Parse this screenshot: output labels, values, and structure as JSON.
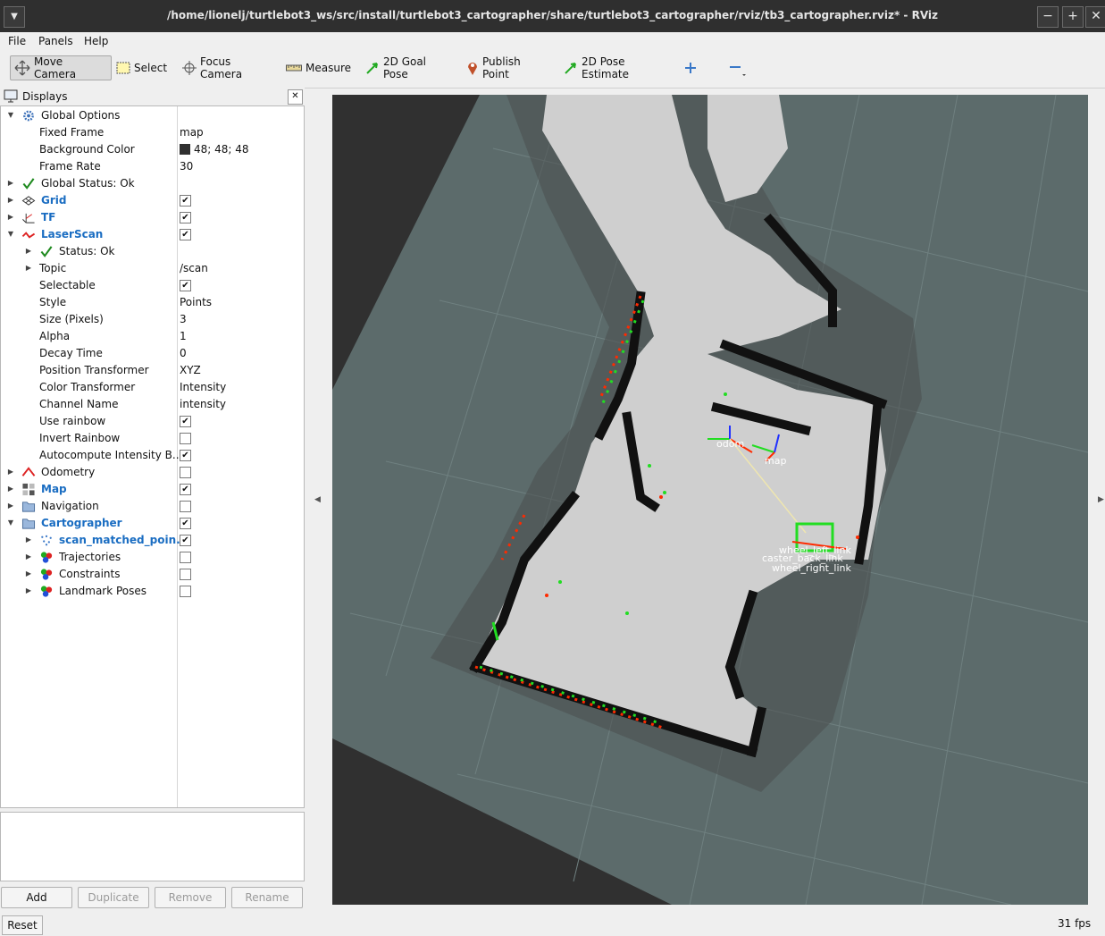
{
  "window": {
    "title": "/home/lionelj/turtlebot3_ws/src/install/turtlebot3_cartographer/share/turtlebot3_cartographer/rviz/tb3_cartographer.rviz* - RViz",
    "menu_icon": "chevron-down-icon",
    "minimize": "−",
    "maximize": "+",
    "close": "✕"
  },
  "menu": {
    "file": "File",
    "panels": "Panels",
    "help": "Help"
  },
  "toolbar": {
    "move_camera": "Move Camera",
    "select": "Select",
    "focus_camera": "Focus Camera",
    "measure": "Measure",
    "goal_pose": "2D Goal Pose",
    "publish_point": "Publish Point",
    "pose_estimate": "2D Pose Estimate"
  },
  "displays": {
    "title": "Displays",
    "close": "✕",
    "rows": [
      {
        "label": "Global Options",
        "expanded": true,
        "icon": "gear-icon"
      },
      {
        "label": "Fixed Frame",
        "value": "map"
      },
      {
        "label": "Background Color",
        "value": "48; 48; 48",
        "color": "#303030"
      },
      {
        "label": "Frame Rate",
        "value": "30"
      },
      {
        "label": "Global Status: Ok",
        "icon": "check-icon"
      },
      {
        "label": "Grid",
        "checked": true,
        "icon": "grid-icon"
      },
      {
        "label": "TF",
        "checked": true,
        "icon": "tf-icon"
      },
      {
        "label": "LaserScan",
        "checked": true,
        "expanded": true,
        "icon": "laserscan-icon"
      },
      {
        "label": "Status: Ok",
        "icon": "check-icon"
      },
      {
        "label": "Topic",
        "value": "/scan"
      },
      {
        "label": "Selectable",
        "checked": true
      },
      {
        "label": "Style",
        "value": "Points"
      },
      {
        "label": "Size (Pixels)",
        "value": "3"
      },
      {
        "label": "Alpha",
        "value": "1"
      },
      {
        "label": "Decay Time",
        "value": "0"
      },
      {
        "label": "Position Transformer",
        "value": "XYZ"
      },
      {
        "label": "Color Transformer",
        "value": "Intensity"
      },
      {
        "label": "Channel Name",
        "value": "intensity"
      },
      {
        "label": "Use rainbow",
        "checked": true
      },
      {
        "label": "Invert Rainbow",
        "checked": false
      },
      {
        "label": "Autocompute Intensity B...",
        "checked": true
      },
      {
        "label": "Odometry",
        "checked": false,
        "icon": "odometry-icon"
      },
      {
        "label": "Map",
        "checked": true,
        "icon": "map-icon"
      },
      {
        "label": "Navigation",
        "checked": false,
        "icon": "folder-icon"
      },
      {
        "label": "Cartographer",
        "checked": true,
        "expanded": true,
        "icon": "folder-icon"
      },
      {
        "label": "scan_matched_poin...",
        "checked": true,
        "icon": "pointcloud-icon"
      },
      {
        "label": "Trajectories",
        "checked": false,
        "icon": "markers-icon"
      },
      {
        "label": "Constraints",
        "checked": false,
        "icon": "markers-icon"
      },
      {
        "label": "Landmark Poses",
        "checked": false,
        "icon": "markers-icon"
      }
    ]
  },
  "buttons": {
    "add": "Add",
    "duplicate": "Duplicate",
    "remove": "Remove",
    "rename": "Rename",
    "reset": "Reset"
  },
  "status": {
    "fps": "31 fps"
  },
  "viewport": {
    "background": "#303030",
    "frames": {
      "odom": "odom",
      "map": "map",
      "wheel_left": "wheel_left_link",
      "caster": "caster_back_link",
      "wheel_right": "wheel_right_link"
    }
  },
  "colors": {
    "titlebar": "#2f2f2f",
    "accent_blue": "#1a6dc2",
    "grid_plane": "#5c6c6c",
    "free_space": "#cfcfcf",
    "laser_red": "#ff2a00",
    "laser_green": "#22dd22"
  }
}
